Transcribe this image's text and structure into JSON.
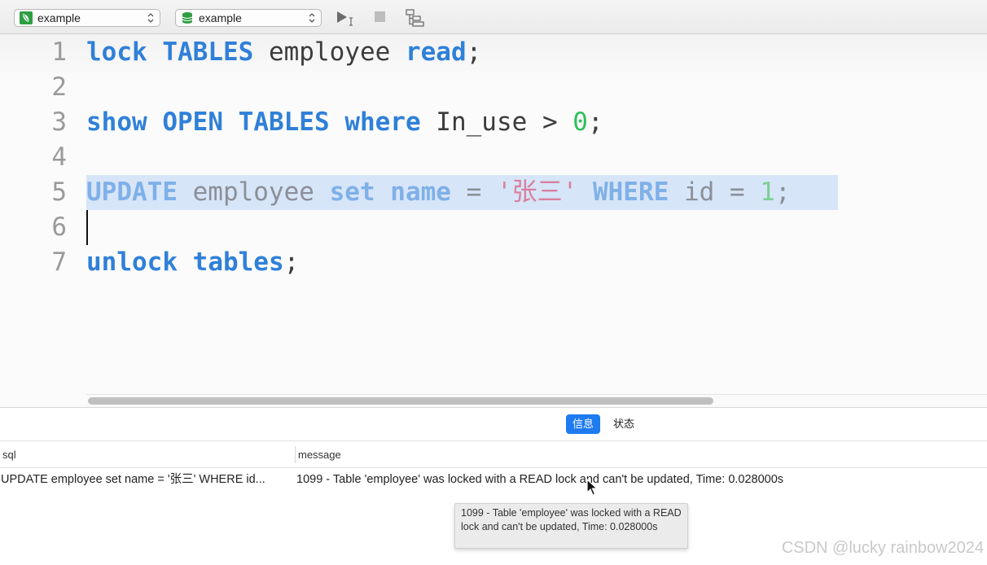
{
  "toolbar": {
    "connection_select": {
      "label": "example",
      "icon": "leaf-icon"
    },
    "database_select": {
      "label": "example",
      "icon": "database-icon"
    },
    "run_icon": "run-cursor-icon",
    "stop_icon": "stop-icon",
    "explain_icon": "explain-icon"
  },
  "editor": {
    "line_numbers": [
      "1",
      "2",
      "3",
      "4",
      "5",
      "6",
      "7"
    ],
    "lines": [
      [
        {
          "t": "lock",
          "c": "kw"
        },
        {
          "t": " "
        },
        {
          "t": "TABLES",
          "c": "kw"
        },
        {
          "t": " employee "
        },
        {
          "t": "read",
          "c": "kw"
        },
        {
          "t": ";"
        }
      ],
      [],
      [
        {
          "t": "show",
          "c": "kw"
        },
        {
          "t": " "
        },
        {
          "t": "OPEN",
          "c": "kw"
        },
        {
          "t": " "
        },
        {
          "t": "TABLES",
          "c": "kw"
        },
        {
          "t": " "
        },
        {
          "t": "where",
          "c": "kw"
        },
        {
          "t": " In_use > "
        },
        {
          "t": "0",
          "c": "num"
        },
        {
          "t": ";"
        }
      ],
      [],
      [
        {
          "t": "UPDATE",
          "c": "kw"
        },
        {
          "t": " employee "
        },
        {
          "t": "set",
          "c": "kw"
        },
        {
          "t": " "
        },
        {
          "t": "name",
          "c": "kw"
        },
        {
          "t": " = "
        },
        {
          "t": "'张三'",
          "c": "str"
        },
        {
          "t": " "
        },
        {
          "t": "WHERE",
          "c": "kw"
        },
        {
          "t": " id = "
        },
        {
          "t": "1",
          "c": "num"
        },
        {
          "t": ";"
        }
      ],
      [],
      [
        {
          "t": "unlock",
          "c": "kw"
        },
        {
          "t": " "
        },
        {
          "t": "tables",
          "c": "kw"
        },
        {
          "t": ";"
        }
      ]
    ],
    "selected_line": 5
  },
  "results": {
    "tabs": [
      {
        "label": "信息",
        "active": true
      },
      {
        "label": "状态",
        "active": false
      }
    ],
    "columns": [
      "sql",
      "message"
    ],
    "row": {
      "sql": "UPDATE employee set name = '张三' WHERE id...",
      "message": "1099 - Table 'employee' was locked with a READ lock and can't be updated, Time: 0.028000s"
    },
    "tooltip": "1099 - Table 'employee' was locked with a READ lock and can't be updated, Time: 0.028000s"
  },
  "watermark": "CSDN @lucky rainbow2024",
  "colors": {
    "keyword": "#2f80d8",
    "number": "#2fbf5a",
    "string": "#d63a6a",
    "selection": "#d7e5f8",
    "active_tab": "#1e7bf0"
  }
}
